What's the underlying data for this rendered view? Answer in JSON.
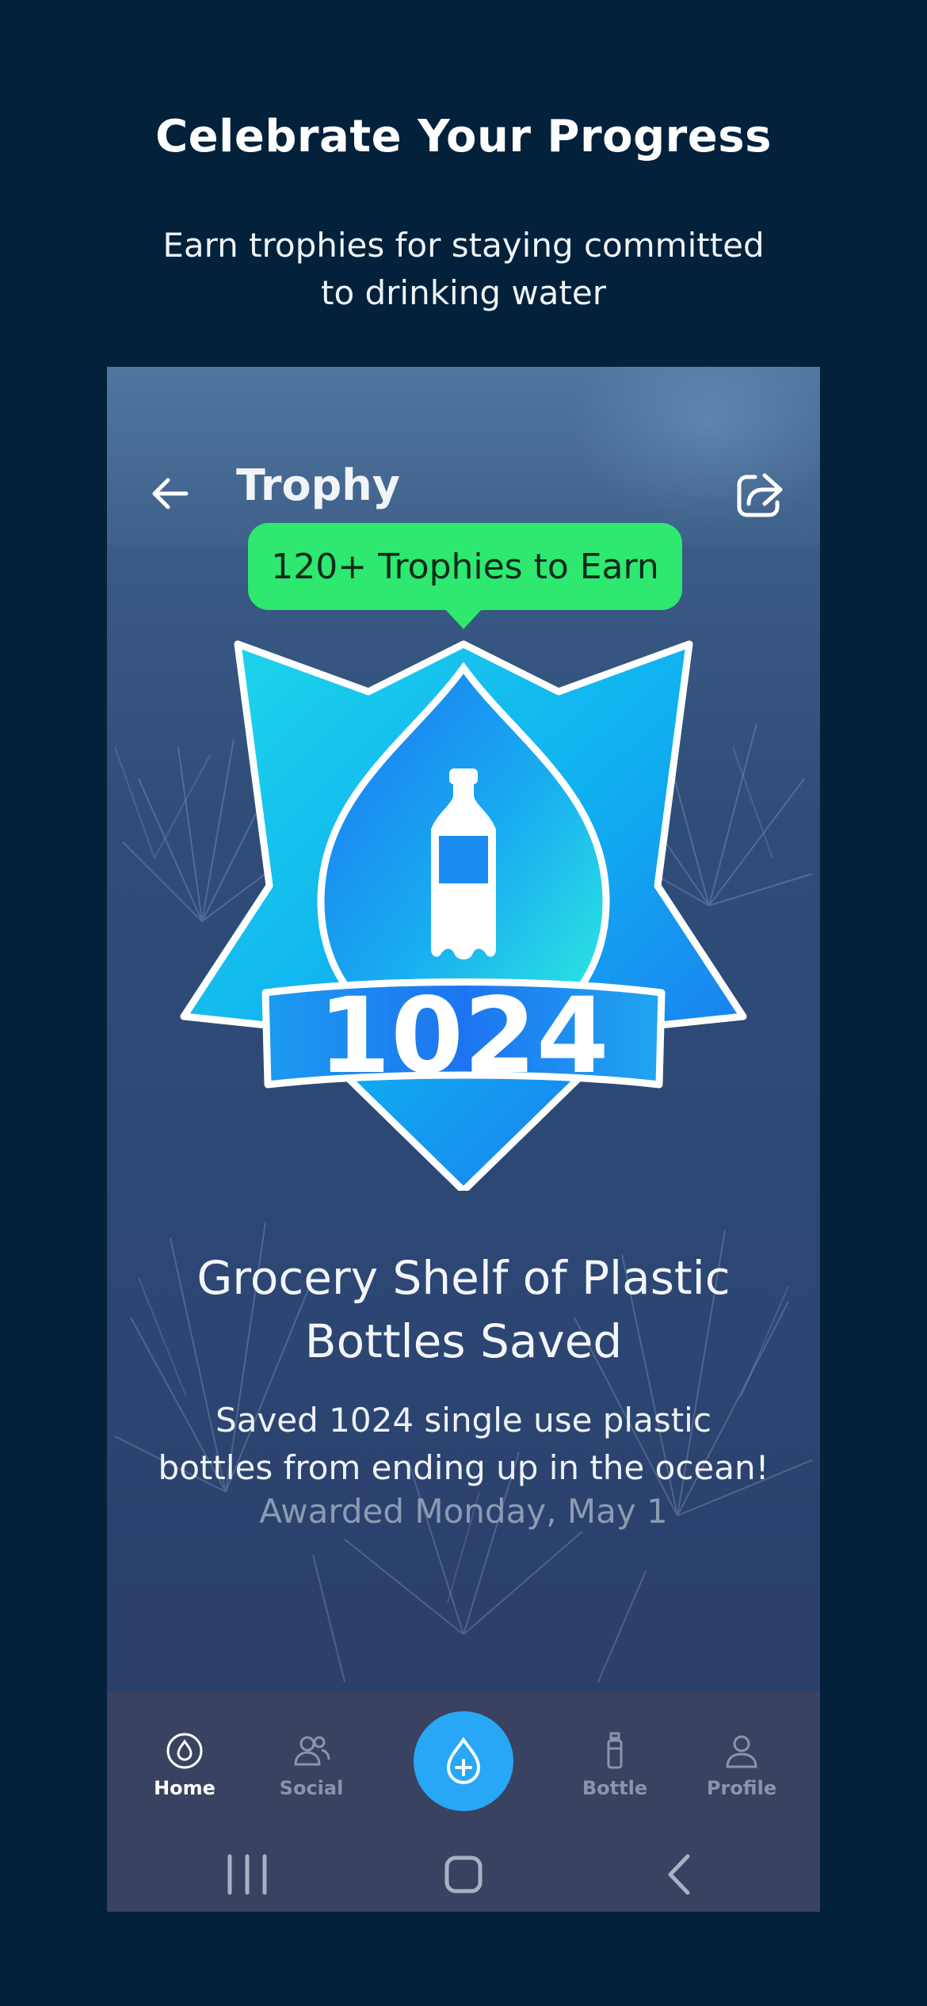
{
  "promo": {
    "title": "Celebrate Your Progress",
    "subtitle": "Earn trophies for staying committed to drinking water"
  },
  "header": {
    "title": "Trophy",
    "back_icon": "arrow-left-icon",
    "share_icon": "share-icon"
  },
  "tooltip": {
    "text": "120+ Trophies to Earn"
  },
  "badge": {
    "number": "1024",
    "icon": "plastic-bottle-icon"
  },
  "trophy": {
    "name": "Grocery Shelf of Plastic Bottles Saved",
    "description": "Saved 1024 single use plastic bottles from ending up in the ocean!",
    "awarded": "Awarded Monday, May 1"
  },
  "tabbar": {
    "tabs": [
      {
        "label": "Home",
        "icon": "water-drop-icon",
        "active": true
      },
      {
        "label": "Social",
        "icon": "people-icon",
        "active": false
      },
      {
        "label": "Bottle",
        "icon": "bottle-icon",
        "active": false
      },
      {
        "label": "Profile",
        "icon": "person-icon",
        "active": false
      }
    ],
    "fab_icon": "add-water-drop-icon"
  },
  "system_nav": {
    "icons": [
      "recents-icon",
      "home-icon",
      "back-icon"
    ]
  },
  "colors": {
    "background": "#03213a",
    "tooltip": "#2ee870",
    "fab": "#27a7f5",
    "tabbar": "#3a4261",
    "badge_blue": "#1f7cf0",
    "badge_cyan": "#22d6e6"
  }
}
